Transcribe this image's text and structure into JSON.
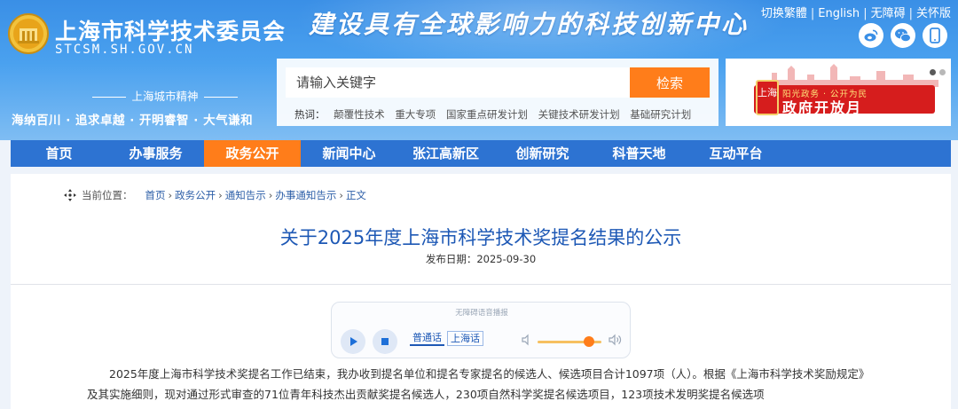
{
  "header": {
    "org_name": "上海市科学技术委员会",
    "domain": "STCSM.SH.GOV.CN",
    "slogan": "建设具有全球影响力的科技创新中心",
    "top_links": [
      "切换繁體",
      "English",
      "无障碍",
      "关怀版"
    ],
    "social_icons": [
      "weibo-icon",
      "wechat-icon",
      "mobile-icon"
    ],
    "spirit_label": "上海城市精神",
    "spirit_text": "海纳百川 · 追求卓越 · 开明睿智 · 大气谦和"
  },
  "search": {
    "placeholder": "请输入关键字",
    "button_label": "检索",
    "hot_label": "热词：",
    "hot_words": [
      "颠覆性技术",
      "重大专项",
      "国家重点研发计划",
      "关键技术研发计划",
      "基础研究计划"
    ]
  },
  "banner": {
    "badge": "上海",
    "top_line": "阳光政务 · 公开为民",
    "main_line": "政府开放月",
    "slides": 2,
    "active_slide": 1
  },
  "nav": {
    "items": [
      "首页",
      "办事服务",
      "政务公开",
      "新闻中心",
      "张江高新区",
      "创新研究",
      "科普天地",
      "互动平台"
    ],
    "active_index": 2
  },
  "breadcrumb": {
    "label": "当前位置：",
    "items": [
      "首页",
      "政务公开",
      "通知告示",
      "办事通知告示",
      "正文"
    ]
  },
  "article": {
    "title": "关于2025年度上海市科学技术奖提名结果的公示",
    "date_label": "发布日期：",
    "date": "2025-09-30",
    "body": [
      "2025年度上海市科学技术奖提名工作已结束，我办收到提名单位和提名专家提名的候选人、候选项目合计1097项（人）。根据《上海市科学技术奖励规定》及其实施细则，现对通过形式审查的71位青年科技杰出贡献奖提名候选人，230项自然科学奖提名候选项目，123项技术发明奖提名候选项"
    ]
  },
  "tts": {
    "title": "无障碍语音播报",
    "languages": [
      "普通话",
      "上海话"
    ],
    "selected_language": "普通话",
    "volume": 0.75
  },
  "colors": {
    "header_blue": "#3a8fe6",
    "nav_blue": "#2d73d2",
    "accent_orange": "#ff7d1a",
    "title_blue": "#1d58b5",
    "banner_red": "#d61d1d"
  }
}
